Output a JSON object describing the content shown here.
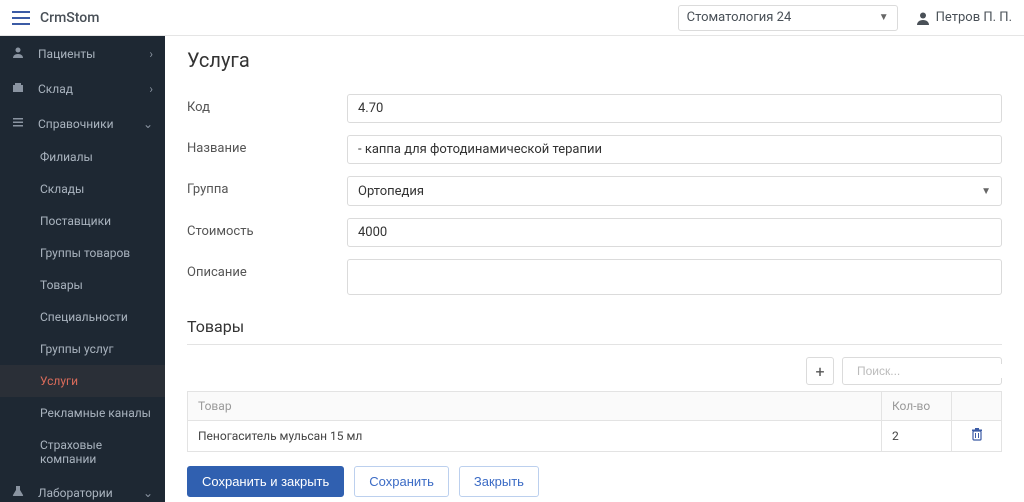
{
  "topbar": {
    "brand": "CrmStom",
    "org": "Стоматология 24",
    "user": "Петров П. П."
  },
  "sidebar": {
    "items": [
      {
        "label": "Пациенты",
        "icon": "patients",
        "expandable": true
      },
      {
        "label": "Склад",
        "icon": "warehouse",
        "expandable": true
      },
      {
        "label": "Справочники",
        "icon": "refs",
        "expandable": true,
        "expanded": true
      },
      {
        "label": "Лаборатории",
        "icon": "labs",
        "expandable": true
      }
    ],
    "sub": [
      {
        "label": "Филиалы"
      },
      {
        "label": "Склады"
      },
      {
        "label": "Поставщики"
      },
      {
        "label": "Группы товаров"
      },
      {
        "label": "Товары"
      },
      {
        "label": "Специальности"
      },
      {
        "label": "Группы услуг"
      },
      {
        "label": "Услуги",
        "active": true
      },
      {
        "label": "Рекламные каналы"
      },
      {
        "label": "Страховые компании"
      }
    ]
  },
  "page": {
    "title": "Услуга",
    "labels": {
      "code": "Код",
      "name": "Название",
      "group": "Группа",
      "price": "Стоимость",
      "desc": "Описание"
    },
    "values": {
      "code": "4.70",
      "name": "- каппа для фотодинамической терапии",
      "group": "Ортопедия",
      "price": "4000",
      "desc": ""
    },
    "goods_title": "Товары",
    "search_placeholder": "Поиск...",
    "table": {
      "headers": {
        "name": "Товар",
        "qty": "Кол-во"
      },
      "rows": [
        {
          "name": "Пеногаситель мульсан 15 мл",
          "qty": "2"
        }
      ]
    },
    "buttons": {
      "save_close": "Сохранить и закрыть",
      "save": "Сохранить",
      "close": "Закрыть"
    }
  }
}
